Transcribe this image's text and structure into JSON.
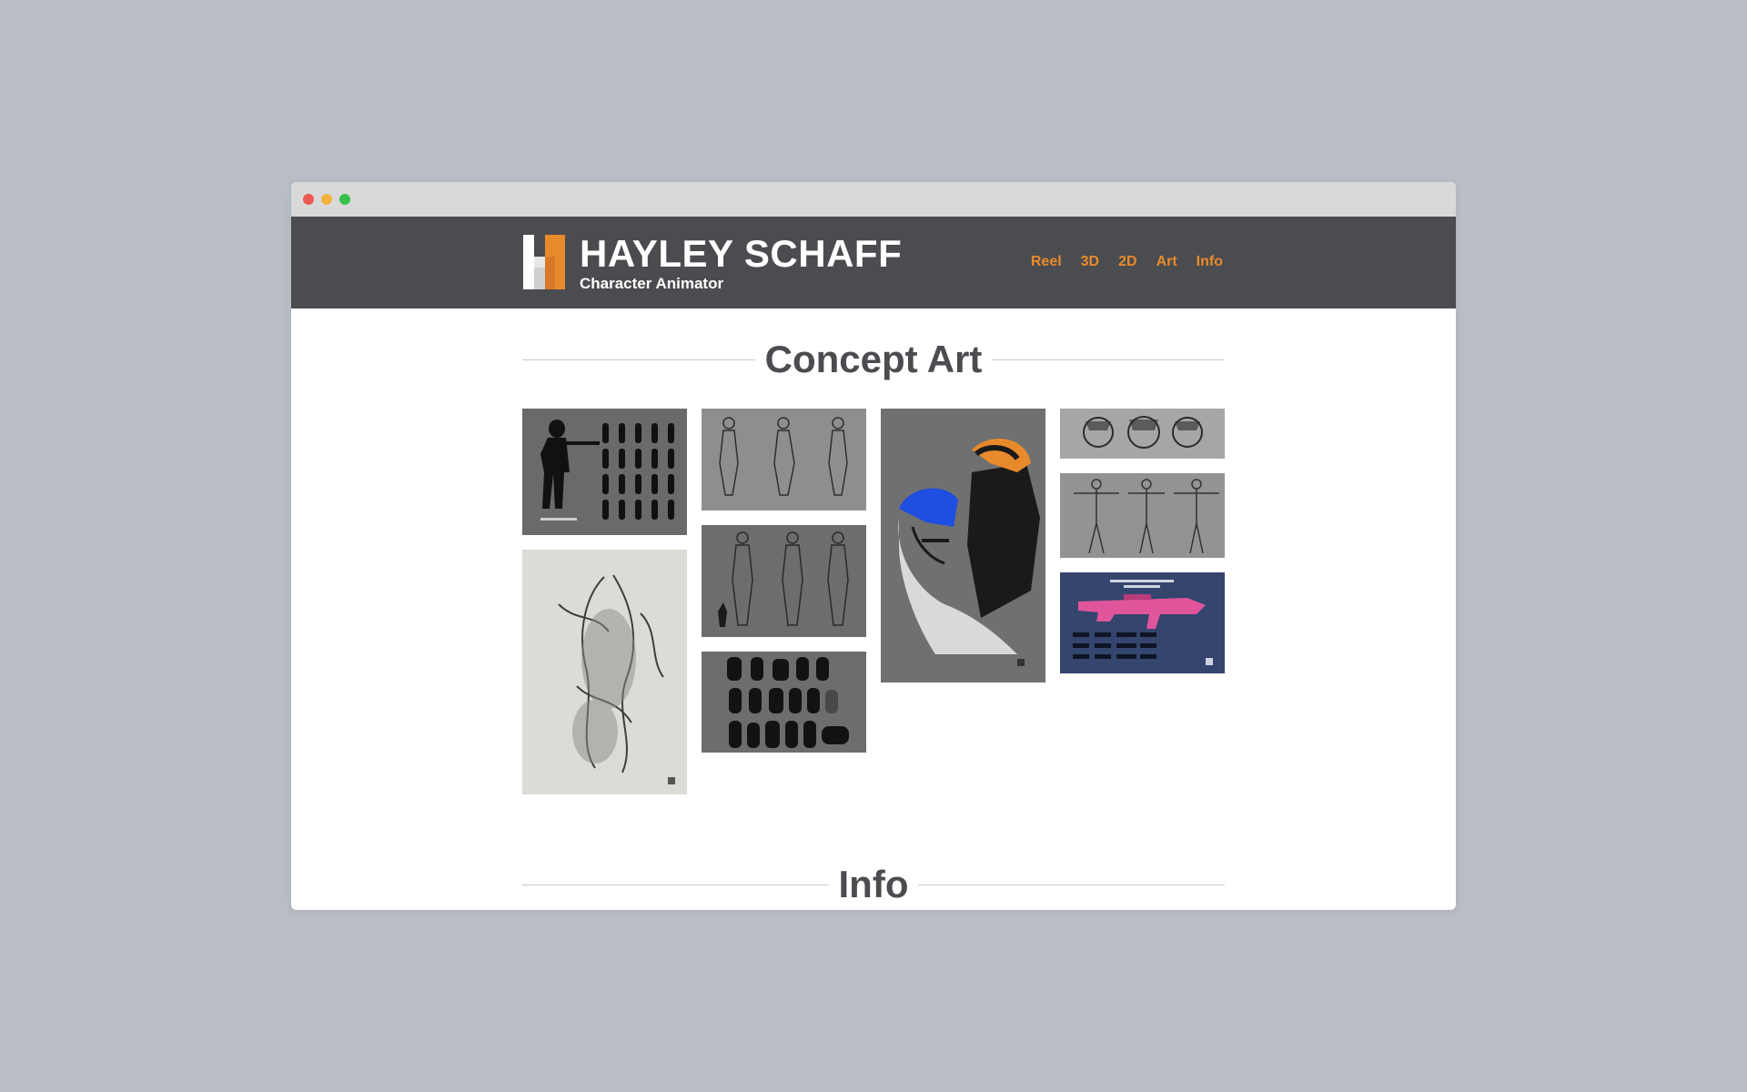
{
  "browser": {
    "controls": [
      "close",
      "minimize",
      "maximize"
    ]
  },
  "header": {
    "name": "HAYLEY SCHAFF",
    "subtitle": "Character Animator",
    "nav": [
      "Reel",
      "3D",
      "2D",
      "Art",
      "Info"
    ]
  },
  "sections": {
    "concept_art": "Concept Art",
    "info": "Info"
  },
  "colors": {
    "page_background": "#b9bdc5",
    "header_background": "#4b4c50",
    "accent": "#e88a2c",
    "heading_text": "#4b4c50"
  },
  "gallery": [
    {
      "name": "silhouette-lineup-sheet",
      "bg": "#6a6a6a"
    },
    {
      "name": "scifi-figure-drawing",
      "bg": "#dcdcd6"
    },
    {
      "name": "outfit-sketch-sheet",
      "bg": "#8e8e8e"
    },
    {
      "name": "costume-lineup-sheet",
      "bg": "#6d6d6d"
    },
    {
      "name": "creature-silhouettes",
      "bg": "#6d6d6d"
    },
    {
      "name": "blue-orange-portrait",
      "bg": "#707070"
    },
    {
      "name": "head-sketches",
      "bg": "#a6a6a6"
    },
    {
      "name": "turnaround-sheet",
      "bg": "#939393"
    },
    {
      "name": "pink-weapon-design",
      "bg": "#34456e"
    }
  ]
}
